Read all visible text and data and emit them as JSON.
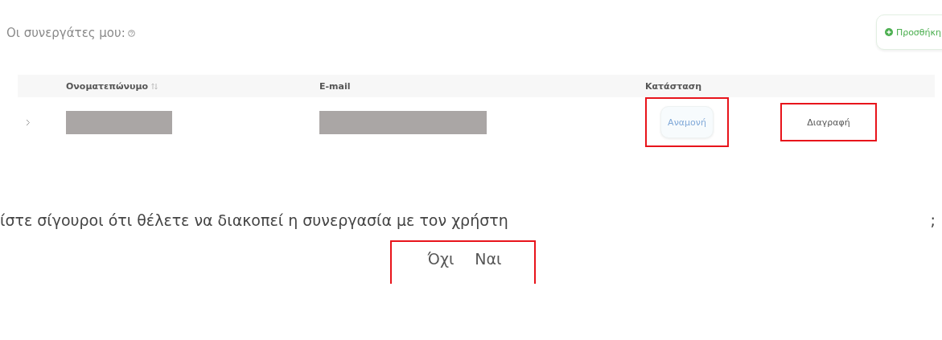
{
  "section": {
    "title": "Οι συνεργάτες μου:",
    "add_button": "Προσθήκη"
  },
  "table": {
    "columns": [
      {
        "label": "Ονοματεπώνυμο",
        "sortable": true
      },
      {
        "label": "E-mail",
        "sortable": false
      },
      {
        "label": "Κατάσταση",
        "sortable": false
      }
    ],
    "rows": [
      {
        "expanded": false,
        "status": "Αναμονή",
        "status_highlighted": true,
        "action": "Διαγραφή",
        "action_highlighted": true
      }
    ]
  },
  "dialog": {
    "message": "ίστε σίγουροι ότι θέλετε να διακοπεί η συνεργασία με τον χρήστη",
    "end_mark": ";",
    "buttons_highlighted": true,
    "buttons": [
      {
        "label": "Όχι"
      },
      {
        "label": "Ναι"
      }
    ]
  }
}
